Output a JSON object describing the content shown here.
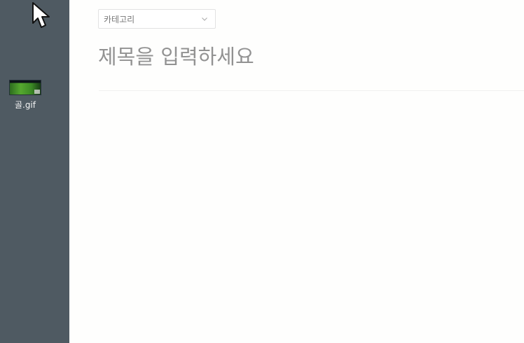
{
  "desktop": {
    "file": {
      "name": "골.gif",
      "icon": "gif-file-thumbnail-icon"
    },
    "cursor_icon": "arrow-cursor-icon"
  },
  "editor": {
    "category": {
      "selected": "카테고리",
      "icon": "chevron-down-icon"
    },
    "title": {
      "placeholder": "제목을 입력하세요"
    }
  },
  "colors": {
    "desktop_background": "#4f5a62",
    "editor_background": "#fefefd",
    "placeholder_text": "#929292"
  }
}
